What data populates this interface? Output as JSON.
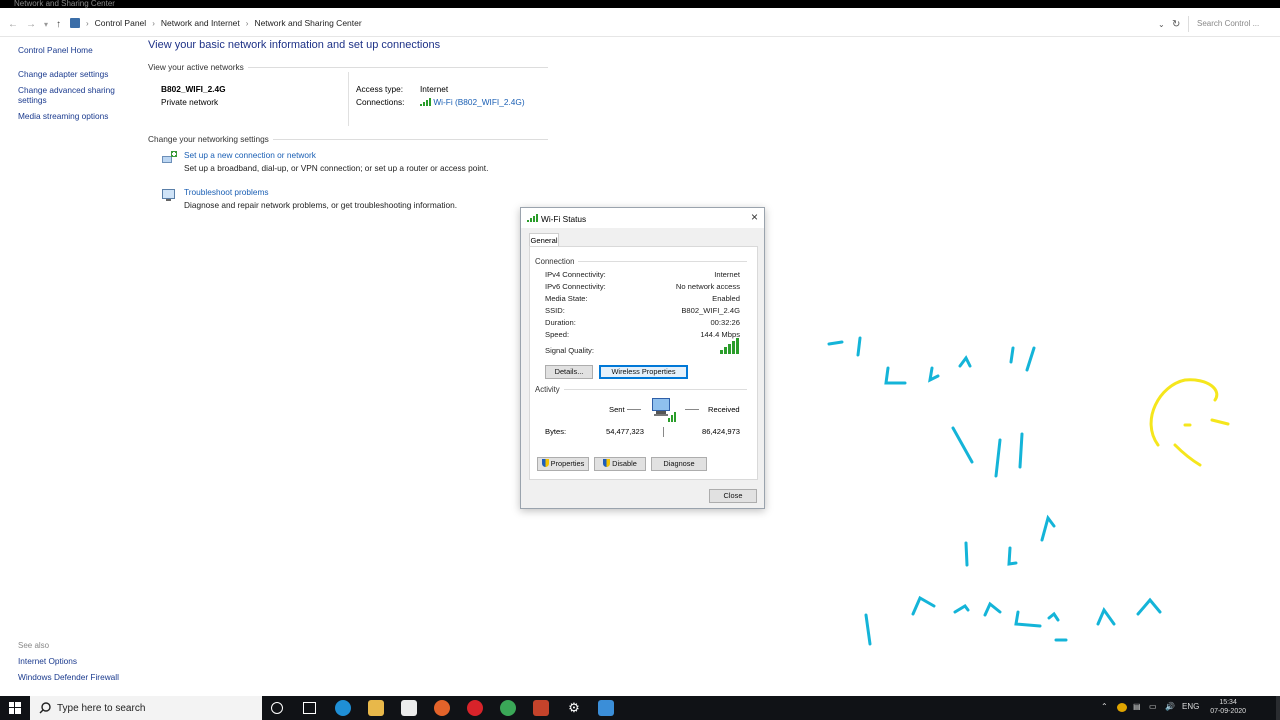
{
  "window": {
    "title": "Network and Sharing Center"
  },
  "address": {
    "crumbs": [
      "Control Panel",
      "Network and Internet",
      "Network and Sharing Center"
    ],
    "search_placeholder": "Search Control ..."
  },
  "sidebar": {
    "items": [
      {
        "label": "Control Panel Home"
      },
      {
        "label": "Change adapter settings"
      },
      {
        "label": "Change advanced sharing settings"
      },
      {
        "label": "Media streaming options"
      }
    ],
    "see_also_heading": "See also",
    "see_also": [
      {
        "label": "Internet Options"
      },
      {
        "label": "Windows Defender Firewall"
      }
    ]
  },
  "main": {
    "title": "View your basic network information and set up connections",
    "active_heading": "View your active networks",
    "network": {
      "name": "B802_WIFI_2.4G",
      "type": "Private network",
      "access_label": "Access type:",
      "access_value": "Internet",
      "connections_label": "Connections:",
      "connections_value": "Wi-Fi (B802_WIFI_2.4G)"
    },
    "change_heading": "Change your networking settings",
    "tasks": [
      {
        "title": "Set up a new connection or network",
        "desc": "Set up a broadband, dial-up, or VPN connection; or set up a router or access point."
      },
      {
        "title": "Troubleshoot problems",
        "desc": "Diagnose and repair network problems, or get troubleshooting information."
      }
    ]
  },
  "dialog": {
    "title": "Wi-Fi Status",
    "tab": "General",
    "connection_heading": "Connection",
    "rows": [
      {
        "label": "IPv4 Connectivity:",
        "value": "Internet"
      },
      {
        "label": "IPv6 Connectivity:",
        "value": "No network access"
      },
      {
        "label": "Media State:",
        "value": "Enabled"
      },
      {
        "label": "SSID:",
        "value": "B802_WIFI_2.4G"
      },
      {
        "label": "Duration:",
        "value": "00:32:26"
      },
      {
        "label": "Speed:",
        "value": "144.4 Mbps"
      }
    ],
    "signal_label": "Signal Quality:",
    "signal_bars": 5,
    "details_button": "Details...",
    "wireless_button": "Wireless Properties",
    "activity_heading": "Activity",
    "sent_label": "Sent",
    "received_label": "Received",
    "bytes_label": "Bytes:",
    "bytes_sent": "54,477,323",
    "bytes_received": "86,424,973",
    "properties_button": "Properties",
    "disable_button": "Disable",
    "diagnose_button": "Diagnose",
    "close_button": "Close"
  },
  "taskbar": {
    "search_text": "Type here to search",
    "lang": "ENG",
    "time": "15:34",
    "date": "07-09-2020"
  },
  "colors": {
    "link": "#1a5fb4",
    "ink_cyan": "#14b4d8",
    "ink_yellow": "#f5e61c",
    "taskbar": "#101216"
  }
}
